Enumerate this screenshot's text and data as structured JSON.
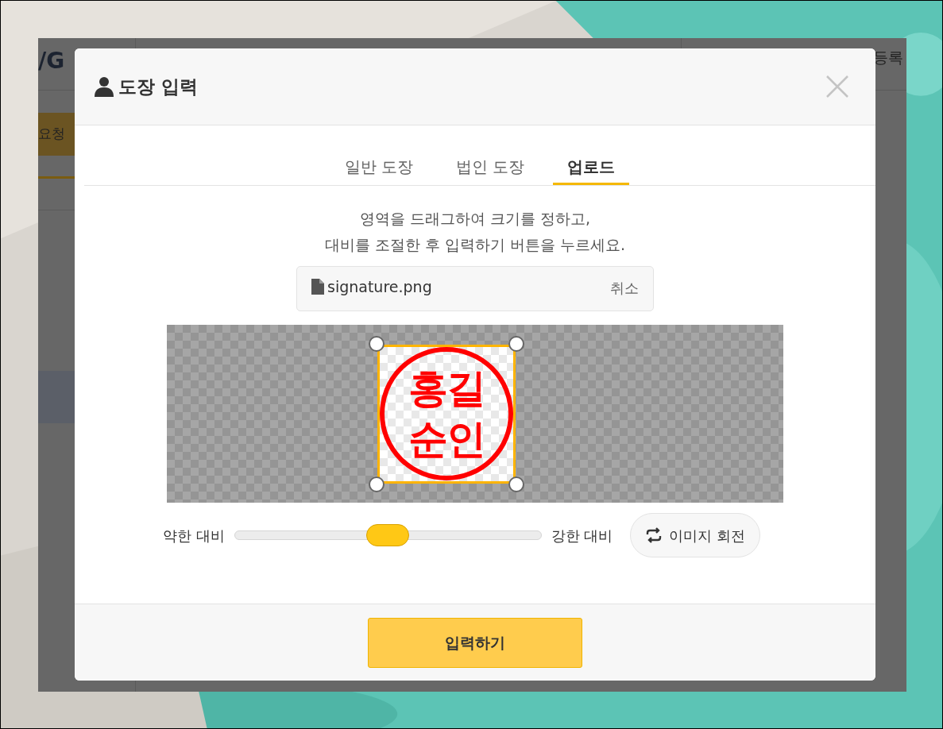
{
  "background_app": {
    "logo": "/G",
    "header_right": "등록",
    "sidebar_button": "요청"
  },
  "dialog": {
    "title": "도장 입력",
    "tabs": [
      {
        "label": "일반 도장",
        "selected": false
      },
      {
        "label": "법인 도장",
        "selected": false
      },
      {
        "label": "업로드",
        "selected": true
      }
    ],
    "instructions": [
      "영역을 드래그하여 크기를 정하고,",
      "대비를 조절한 후 입력하기 버튼을 누르세요."
    ],
    "file": {
      "name": "signature.png",
      "cancel": "취소"
    },
    "stamp": {
      "lines": [
        "홍길",
        "순인"
      ]
    },
    "contrast": {
      "min_label": "약한 대비",
      "max_label": "강한 대비",
      "level": 0.5
    },
    "rotate_button": "이미지 회전",
    "submit_button": "입력하기"
  }
}
